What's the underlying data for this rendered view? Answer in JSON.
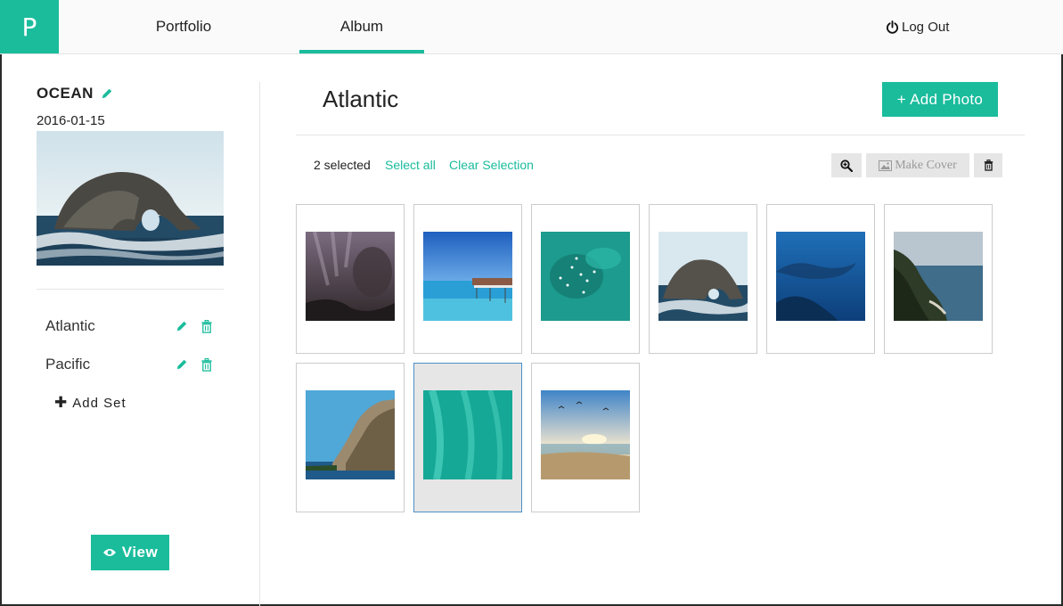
{
  "app": {
    "logo_letter": "P",
    "nav": [
      {
        "label": "Portfolio",
        "active": false
      },
      {
        "label": "Album",
        "active": true
      }
    ],
    "logout_label": "Log Out",
    "accent": "#1abc9c"
  },
  "sidebar": {
    "album_title": "OCEAN",
    "album_date": "2016-01-15",
    "sets": [
      {
        "label": "Atlantic"
      },
      {
        "label": "Pacific"
      }
    ],
    "add_set_label": "Add Set",
    "view_label": "View"
  },
  "main": {
    "set_title": "Atlantic",
    "add_photo_label": "+ Add Photo",
    "selected_count": "2 selected",
    "select_all_label": "Select all",
    "clear_selection_label": "Clear Selection",
    "make_cover_label": "Make Cover",
    "photos": [
      {
        "name": "underwater-fish-school",
        "selected": true
      },
      {
        "name": "pier-over-lagoon",
        "selected": false
      },
      {
        "name": "aerial-reef-swimmers",
        "selected": false
      },
      {
        "name": "rock-arch-sea",
        "selected": false
      },
      {
        "name": "whale-shark-underwater",
        "selected": false
      },
      {
        "name": "coastal-cliffs-bay",
        "selected": false
      },
      {
        "name": "sea-cliff-blue-sky",
        "selected": false
      },
      {
        "name": "aerial-turquoise-water",
        "selected": true
      },
      {
        "name": "sunset-beach-birds",
        "selected": false
      }
    ]
  }
}
